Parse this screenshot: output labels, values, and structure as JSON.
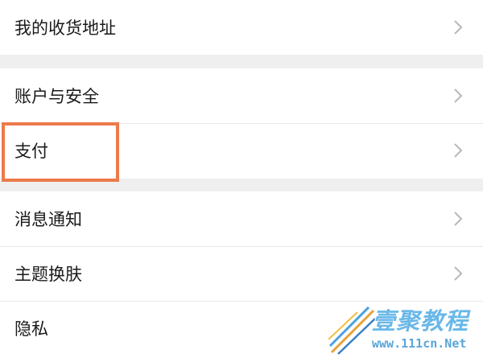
{
  "settings": {
    "group1": [
      {
        "label": "我的收货地址"
      }
    ],
    "group2": [
      {
        "label": "账户与安全"
      },
      {
        "label": "支付"
      }
    ],
    "group3": [
      {
        "label": "消息通知"
      },
      {
        "label": "主题换肤"
      },
      {
        "label": "隐私"
      }
    ]
  },
  "highlight_color": "#ec7a4a",
  "watermark": {
    "name": "壹聚教程",
    "url": "www.111cn.Net"
  }
}
